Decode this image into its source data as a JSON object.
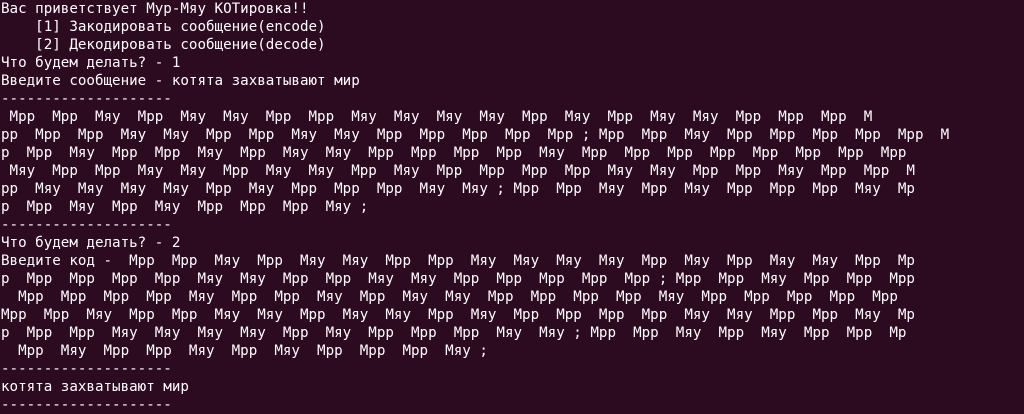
{
  "terminal": {
    "lines": [
      "Вас приветствует Мур-Мяу КОТировка!!",
      "    [1] Закодировать сообщение(encode)",
      "    [2] Декодировать сообщение(decode)",
      "Что будем делать? - 1",
      "Введите сообщение - котята захватывают мир",
      "--------------------",
      " Мрр  Мрр  Мяу  Мрр  Мяу  Мяу  Мрр  Мрр  Мяу  Мяу  Мяу  Мяу  Мрр  Мяу  Мрр  Мяу  Мяу  Мрр  Мрр  Мрр  М",
      "рр  Мрр  Мрр  Мяу  Мяу  Мрр  Мрр  Мяу  Мяу  Мрр  Мрр  Мрр  Мрр  Мрр ; Мрр  Мрр  Мяу  Мрр  Мрр  Мрр  Мрр  Мрр  М",
      "р  Мрр  Мяу  Мрр  Мрр  Мяу  Мрр  Мяу  Мяу  Мрр  Мрр  Мрр  Мрр  Мяу  Мрр  Мрр  Мрр  Мрр  Мрр  Мрр  Мрр  Мрр ",
      " Мяу  Мрр  Мрр  Мяу  Мяу  Мрр  Мяу  Мяу  Мрр  Мяу  Мрр  Мрр  Мрр  Мрр  Мяу  Мяу  Мрр  Мрр  Мяу  Мрр  Мрр  М",
      "рр  Мяу  Мяу  Мяу  Мяу  Мрр  Мяу  Мрр  Мрр  Мрр  Мяу  Мяу ; Мрр  Мрр  Мяу  Мрр  Мяу  Мрр  Мрр  Мрр  Мяу  Мр",
      "р  Мрр  Мяу  Мрр  Мяу  Мрр  Мрр  Мрр  Мяу ;",
      "--------------------",
      "Что будем делать? - 2",
      "Введите код -  Мрр  Мрр  Мяу  Мрр  Мяу  Мяу  Мрр  Мрр  Мяу  Мяу  Мяу  Мяу  Мрр  Мяу  Мрр  Мяу  Мяу  Мрр  Мр",
      "р  Мрр  Мрр  Мрр  Мрр  Мяу  Мяу  Мрр  Мрр  Мяу  Мяу  Мрр  Мрр  Мрр  Мрр  Мрр ; Мрр  Мрр  Мяу  Мрр  Мрр  Мрр",
      "  Мрр  Мрр  Мрр  Мрр  Мяу  Мрр  Мрр  Мяу  Мрр  Мяу  Мяу  Мрр  Мрр  Мрр  Мрр  Мяу  Мрр  Мрр  Мрр  Мрр  Мрр  ",
      "Мрр  Мрр  Мяу  Мрр  Мрр  Мяу  Мяу  Мрр  Мяу  Мяу  Мрр  Мяу  Мрр  Мрр  Мрр  Мрр  Мяу  Мяу  Мрр  Мрр  Мяу  Мр",
      "р  Мрр  Мрр  Мяу  Мяу  Мяу  Мяу  Мрр  Мяу  Мрр  Мрр  Мрр  Мяу  Мяу ; Мрр  Мрр  Мяу  Мрр  Мяу  Мрр  Мрр  Мр",
      "  Мрр  Мяу  Мрр  Мрр  Мяу  Мрр  Мяу  Мрр  Мрр  Мрр  Мяу ;",
      "--------------------",
      "котята захватывают мир",
      "--------------------"
    ]
  }
}
